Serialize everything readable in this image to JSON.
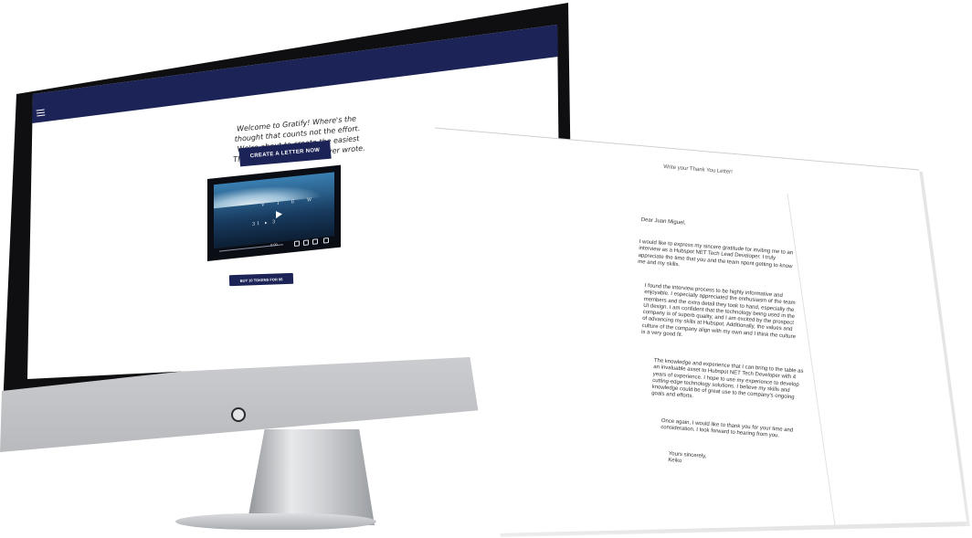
{
  "screen": {
    "hero_text": "Welcome to Gratify! Where's the thought that counts not the effort. We're about to create the easiest Thank You Letter you've ever wrote.",
    "cta_label": "CREATE A LETTER NOW",
    "video": {
      "title": "V I E W",
      "subtitle": "31 ▸ 3",
      "time": "0:00"
    },
    "buy_label": "BUY 10 TOKENS FOR $5"
  },
  "letter": {
    "title": "Write your Thank You Letter!",
    "salutation": "Dear Juan Miguel,",
    "paragraphs": [
      "I would like to express my sincere gratitude for inviting me to an interview as a Hubspot NET Tech Lead Developer. I truly appreciate the time that you and the team spent getting to know me and my skills.",
      "I found the interview process to be highly informative and enjoyable. I especially appreciated the enthusiasm of the team members and the extra detail they took to hand, especially the UI design. I am confident that the technology being used in the company is of superb quality, and I am excited by the prospect of advancing my skills at Hubspot. Additionally, the values and culture of the company align with my own and I think the culture is a very good fit.",
      "The knowledge and experience that I can bring to the table as an invaluable asset to Hubspot NET Tech Developer with 4 years of experience. I hope to use my experience to develop cutting-edge technology solutions. I believe my skills and knowledge could be of great use to the company's ongoing goals and efforts.",
      "Once again, I would like to thank you for your time and consideration. I look forward to hearing from you."
    ],
    "closing": "Yours sincerely,",
    "signature": "Keiko"
  },
  "colors": {
    "navy": "#1c2356",
    "bezel": "#0f0f12"
  }
}
